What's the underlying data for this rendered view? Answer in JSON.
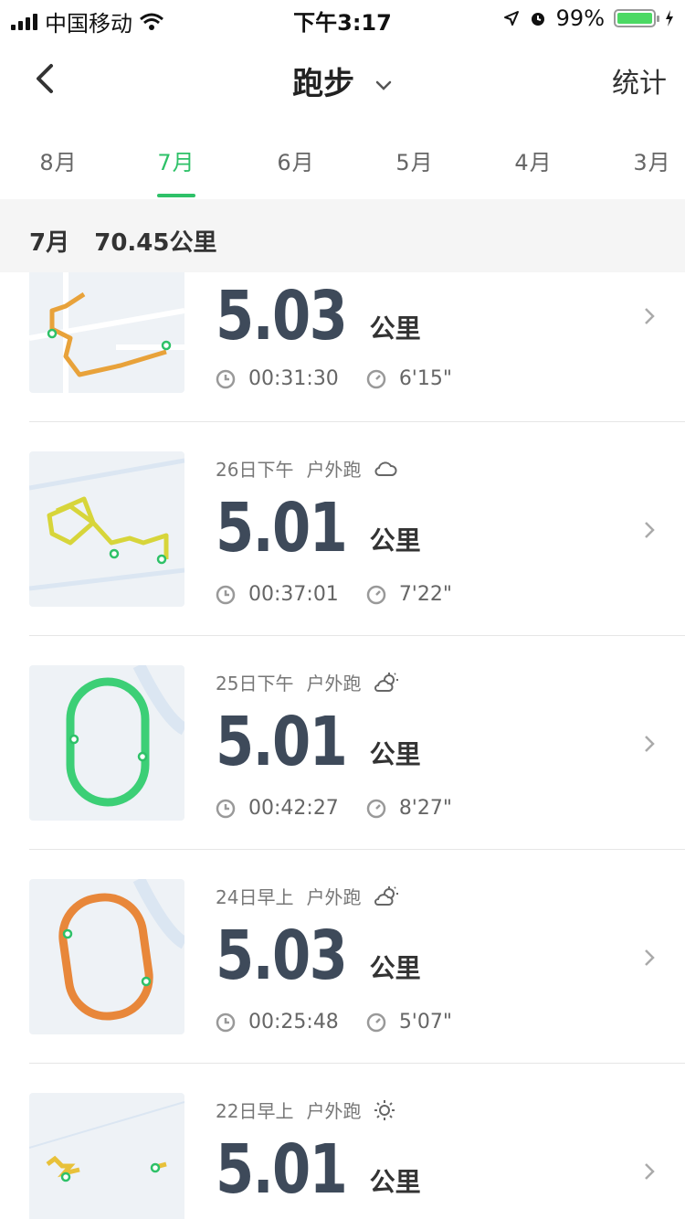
{
  "status": {
    "carrier": "中国移动",
    "time": "下午3:17",
    "battery_text": "99%"
  },
  "nav": {
    "title": "跑步",
    "stats_label": "统计"
  },
  "tabs": [
    {
      "label": "8月",
      "active": false
    },
    {
      "label": "7月",
      "active": true
    },
    {
      "label": "6月",
      "active": false
    },
    {
      "label": "5月",
      "active": false
    },
    {
      "label": "4月",
      "active": false
    },
    {
      "label": "3月",
      "active": false
    }
  ],
  "month_summary": {
    "month": "7月",
    "total": "70.45公里"
  },
  "runs": [
    {
      "date": "",
      "type": "",
      "weather_icon": "",
      "distance": "5.03",
      "unit": "公里",
      "duration": "00:31:30",
      "pace": "6'15\"",
      "route_color": "#e8a23a"
    },
    {
      "date": "26日下午",
      "type": "户外跑",
      "weather_icon": "cloud-icon",
      "distance": "5.01",
      "unit": "公里",
      "duration": "00:37:01",
      "pace": "7'22\"",
      "route_color": "#d7d53a"
    },
    {
      "date": "25日下午",
      "type": "户外跑",
      "weather_icon": "partly-sunny-icon",
      "distance": "5.01",
      "unit": "公里",
      "duration": "00:42:27",
      "pace": "8'27\"",
      "route_color": "#3ccf76"
    },
    {
      "date": "24日早上",
      "type": "户外跑",
      "weather_icon": "partly-sunny-icon",
      "distance": "5.03",
      "unit": "公里",
      "duration": "00:25:48",
      "pace": "5'07\"",
      "route_color": "#e8873a"
    },
    {
      "date": "22日早上",
      "type": "户外跑",
      "weather_icon": "sun-icon",
      "distance": "5.01",
      "unit": "公里",
      "duration": "",
      "pace": "",
      "route_color": "#e8c13a"
    }
  ],
  "colors": {
    "accent": "#2ec168",
    "distance_text": "#3e4a5a",
    "track_start_marker": "#2ec168"
  }
}
